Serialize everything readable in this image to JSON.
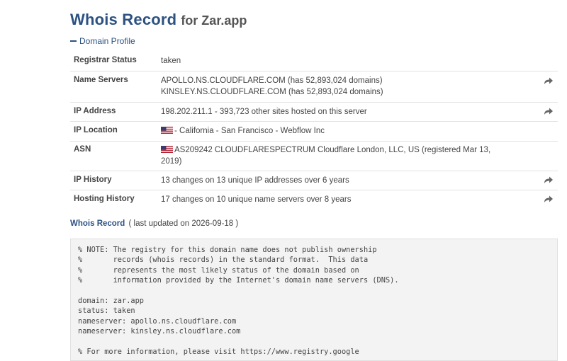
{
  "header": {
    "title": "Whois Record",
    "subtitle": "for Zar.app"
  },
  "domain_profile": {
    "toggle_label": "Domain Profile",
    "rows": [
      {
        "label": "Registrar Status",
        "lines": [
          "taken"
        ]
      },
      {
        "label": "Name Servers",
        "lines": [
          "APOLLO.NS.CLOUDFLARE.COM (has 52,893,024 domains)",
          "KINSLEY.NS.CLOUDFLARE.COM (has 52,893,024 domains)"
        ]
      },
      {
        "label": "IP Address",
        "lines": [
          "198.202.211.1 - 393,723 other sites hosted on this server"
        ]
      },
      {
        "label": "IP Location",
        "lines": [
          "- California - San Francisco - Webflow Inc"
        ]
      },
      {
        "label": "ASN",
        "lines": [
          "AS209242 CLOUDFLARESPECTRUM Cloudflare London, LLC, US (registered Mar 13,",
          "2019)"
        ]
      },
      {
        "label": "IP History",
        "lines": [
          "13 changes on 13 unique IP addresses over 6 years"
        ]
      },
      {
        "label": "Hosting History",
        "lines": [
          "17 changes on 10 unique name servers over 8 years"
        ]
      }
    ]
  },
  "whois_record": {
    "title": "Whois Record",
    "updated": "( last updated on 2026-09-18 )",
    "text": "% NOTE: The registry for this domain name does not publish ownership\n%       records (whois records) in the standard format.  This data\n%       represents the most likely status of the domain based on\n%       information provided by the Internet's domain name servers (DNS).\n\ndomain: zar.app\nstatus: taken\nnameserver: apollo.ns.cloudflare.com\nnameserver: kinsley.ns.cloudflare.com\n\n% For more information, please visit https://www.registry.google"
  },
  "icons": {
    "row_action": "share-arrow-icon",
    "flag": "us-flag-icon"
  },
  "colors": {
    "heading_blue": "#2c5282",
    "raw_background": "#f3f3f3"
  }
}
